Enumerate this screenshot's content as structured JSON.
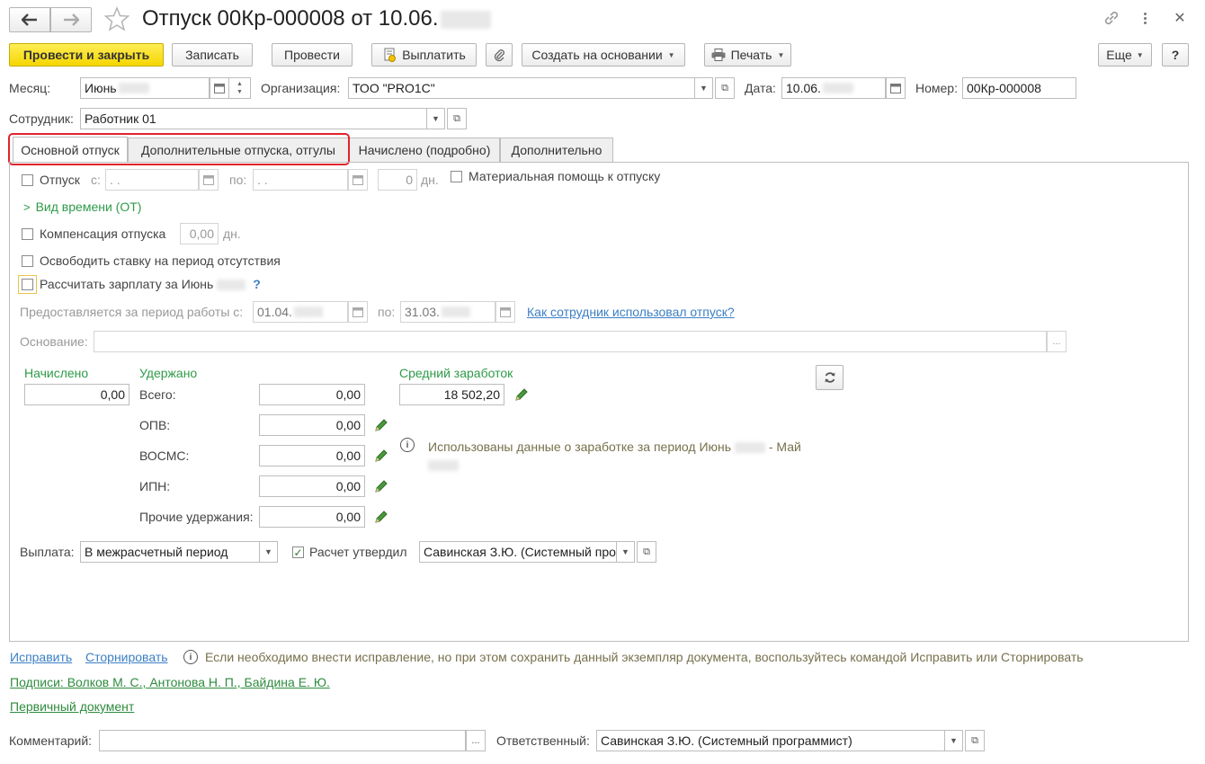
{
  "window": {
    "title": "Отпуск 00Кр-000008 от 10.06.",
    "icons": {
      "back": "arrow-left-icon",
      "forward": "arrow-right-icon",
      "favorite": "star-icon",
      "link": "link-icon",
      "more": "more-vertical-icon",
      "close": "close-icon"
    }
  },
  "toolbar": {
    "post_close": "Провести и закрыть",
    "save": "Записать",
    "post": "Провести",
    "pay": "Выплатить",
    "create_based": "Создать на основании",
    "print": "Печать",
    "more": "Еще",
    "help": "?"
  },
  "header": {
    "month_label": "Месяц:",
    "month_value": "Июнь",
    "org_label": "Организация:",
    "org_value": "ТОО \"PRO1C\"",
    "date_label": "Дата:",
    "date_value": "10.06.",
    "number_label": "Номер:",
    "number_value": "00Кр-000008",
    "employee_label": "Сотрудник:",
    "employee_value": "Работник 01"
  },
  "tabs": [
    {
      "label": "Основной отпуск",
      "active": true
    },
    {
      "label": "Дополнительные отпуска, отгулы",
      "active": false
    },
    {
      "label": "Начислено (подробно)",
      "active": false
    },
    {
      "label": "Дополнительно",
      "active": false
    }
  ],
  "main": {
    "vacation_label": "Отпуск",
    "from_label": "с:",
    "from_value": " .  .",
    "to_label": "по:",
    "to_value": " .  .",
    "days_value": "0",
    "days_unit": "дн.",
    "material_help": "Материальная помощь к отпуску",
    "time_type": "Вид времени (ОТ)",
    "compensation_label": "Компенсация отпуска",
    "compensation_value": "0,00",
    "compensation_unit": "дн.",
    "release_rate": "Освободить ставку на период отсутствия",
    "calc_salary": "Рассчитать зарплату за Июнь",
    "calc_salary_hint": "?",
    "period_label": "Предоставляется за период работы с:",
    "period_from": "01.04.",
    "period_to_label": "по:",
    "period_to": "31.03.",
    "usage_link": "Как сотрудник использовал отпуск?",
    "basis_label": "Основание:",
    "basis_btn": "...",
    "accrued_title": "Начислено",
    "accrued_value": "0,00",
    "withheld_title": "Удержано",
    "withheld": [
      {
        "label": "Всего:",
        "value": "0,00"
      },
      {
        "label": "ОПВ:",
        "value": "0,00"
      },
      {
        "label": "ВОСМС:",
        "value": "0,00"
      },
      {
        "label": "ИПН:",
        "value": "0,00"
      },
      {
        "label": "Прочие удержания:",
        "value": "0,00"
      }
    ],
    "avg_title": "Средний заработок",
    "avg_value": "18 502,20",
    "avg_info": "Использованы данные о заработке за период Июнь",
    "avg_info_tail": "- Май",
    "payout_label": "Выплата:",
    "payout_value": "В межрасчетный период",
    "approved_label": "Расчет утвердил",
    "approved_value": "Савинская З.Ю. (Системный про"
  },
  "footer": {
    "fix_link": "Исправить",
    "storno_link": "Сторнировать",
    "info_text": "Если необходимо внести исправление, но при этом сохранить данный экземпляр документа, воспользуйтесь командой Исправить или Сторнировать",
    "signatures": "Подписи: Волков М. С., Антонова Н. П., Байдина Е. Ю.",
    "primary_doc": "Первичный документ",
    "comment_label": "Комментарий:",
    "comment_btn": "...",
    "responsible_label": "Ответственный:",
    "responsible_value": "Савинская З.Ю. (Системный программист)"
  },
  "colors": {
    "primary_btn": "#f5d600",
    "green": "#2e9b48",
    "link": "#3b7fc4",
    "highlight": "#e0242b"
  }
}
